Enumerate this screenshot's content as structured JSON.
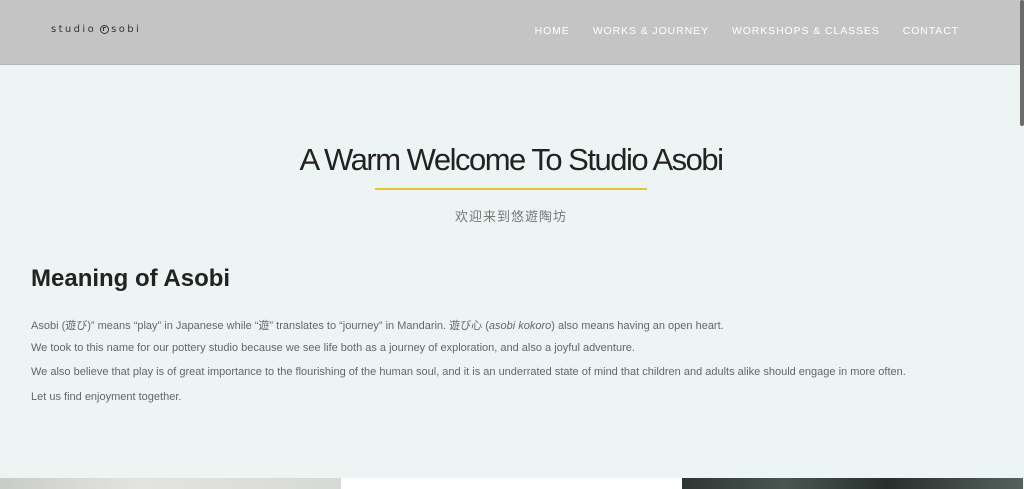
{
  "header": {
    "logo_text_1": "studio",
    "logo_text_2": "sobi",
    "logo_icon": "asobi-circle-mark",
    "nav": [
      {
        "label": "HOME"
      },
      {
        "label": "WORKS & JOURNEY"
      },
      {
        "label": "WORKSHOPS & CLASSES"
      },
      {
        "label": "CONTACT"
      }
    ]
  },
  "hero": {
    "title": "A Warm Welcome To Studio Asobi",
    "subtitle": "欢迎来到悠遊陶坊",
    "accent_color": "#e8c434"
  },
  "section": {
    "title": "Meaning of Asobi",
    "p1_a": "Asobi (遊び)” means “play” in Japanese while “遊” translates to “journey” in Mandarin. 遊び心 (",
    "p1_em": "asobi kokoro",
    "p1_b": ") also means having an open heart.",
    "p2": "We took to this name for our pottery studio because we see life both as a journey of exploration, and also a joyful adventure.",
    "p3": "We also believe that play is of great importance to the flourishing of the human soul, and it is an underrated state of mind that children and adults alike should engage in more often.",
    "p4": "Let us find enjoyment together."
  },
  "colors": {
    "header_bg": "#c4c4c4",
    "page_bg": "#edf4f4"
  }
}
